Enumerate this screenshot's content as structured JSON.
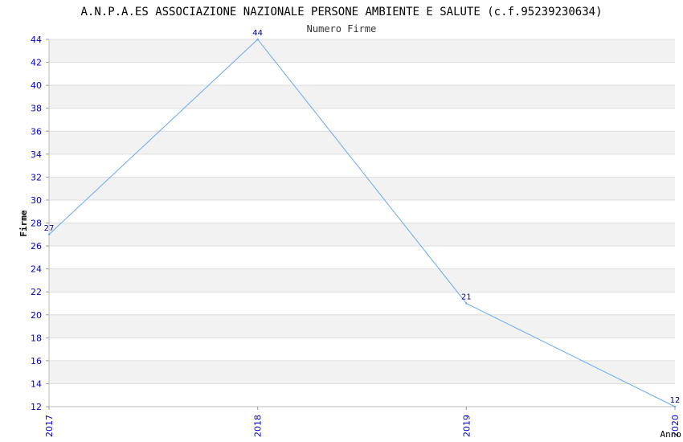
{
  "chart_data": {
    "type": "line",
    "title": "A.N.P.A.ES ASSOCIAZIONE NAZIONALE PERSONE AMBIENTE E SALUTE (c.f.95239230634)",
    "subtitle": "Numero Firme",
    "xlabel": "Anno",
    "ylabel": "Firme",
    "categories": [
      "2017",
      "2018",
      "2019",
      "2020"
    ],
    "series": [
      {
        "values": [
          27,
          44,
          21,
          12
        ]
      }
    ],
    "ylim": [
      12,
      44
    ],
    "yticks": [
      12,
      14,
      16,
      18,
      20,
      22,
      24,
      26,
      28,
      30,
      32,
      34,
      36,
      38,
      40,
      42,
      44
    ],
    "grid": true,
    "data_labels": true,
    "colors": {
      "line": "#66aaee",
      "tick_text": "#0000cc",
      "band": "#f2f2f2",
      "grid": "#dddddd",
      "title_text": "#000000"
    }
  }
}
